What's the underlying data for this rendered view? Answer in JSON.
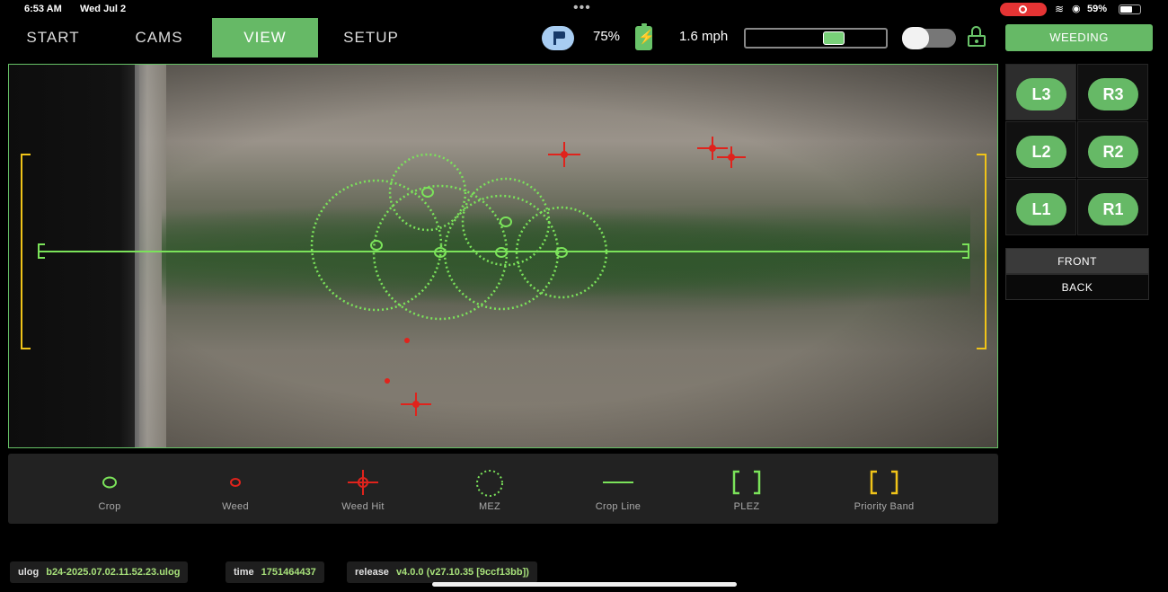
{
  "status_bar": {
    "time": "6:53 AM",
    "date": "Wed Jul 2",
    "battery_percent": "59%",
    "icons": [
      "screen-record-icon",
      "wifi-icon",
      "location-icon",
      "battery-icon"
    ]
  },
  "nav": {
    "tabs": [
      {
        "label": "START",
        "active": false
      },
      {
        "label": "CAMS",
        "active": false
      },
      {
        "label": "VIEW",
        "active": true
      },
      {
        "label": "SETUP",
        "active": false
      }
    ],
    "battery": "75%",
    "speed": "1.6 mph",
    "speed_marker_fraction": 0.65,
    "toggle_on": false,
    "mode_button": "WEEDING"
  },
  "lanes": [
    {
      "label": "L3",
      "selected": true
    },
    {
      "label": "R3",
      "selected": false
    },
    {
      "label": "L2",
      "selected": false
    },
    {
      "label": "R2",
      "selected": false
    },
    {
      "label": "L1",
      "selected": false
    },
    {
      "label": "R1",
      "selected": false
    }
  ],
  "direction": {
    "front_label": "FRONT",
    "back_label": "BACK",
    "active": "front"
  },
  "legend": {
    "items": [
      {
        "key": "crop",
        "label": "Crop"
      },
      {
        "key": "weed",
        "label": "Weed"
      },
      {
        "key": "weed-hit",
        "label": "Weed Hit"
      },
      {
        "key": "mez",
        "label": "MEZ"
      },
      {
        "key": "crop-line",
        "label": "Crop Line"
      },
      {
        "key": "plez",
        "label": "PLEZ"
      },
      {
        "key": "priority-band",
        "label": "Priority Band"
      }
    ]
  },
  "footer": {
    "ulog_key": "ulog",
    "ulog_value": "b24-2025.07.02.11.52.23.ulog",
    "time_key": "time",
    "time_value": "1751464437",
    "release_key": "release",
    "release_value": "v4.0.0 (v27.10.35 [9ccf13bb])"
  },
  "colors": {
    "accent_green": "#66b966",
    "overlay_green": "#7be35a",
    "weed_red": "#e0231c",
    "priority_yellow": "#f0c419"
  }
}
